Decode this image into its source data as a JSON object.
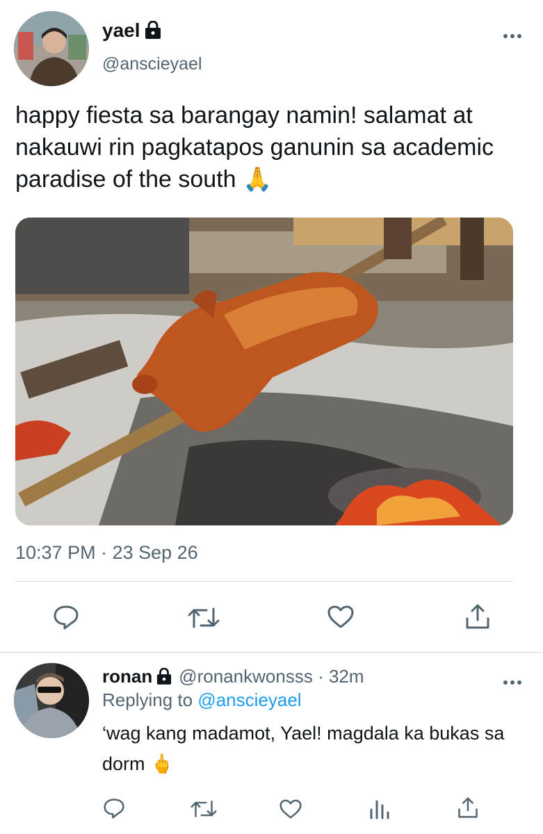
{
  "tweet": {
    "author_name": "yael",
    "author_handle": "@anscieyael",
    "protected_icon": "lock-icon",
    "text": "happy fiesta sa barangay namin! salamat at nakauwi rin pagkatapos ganunin sa academic paradise of the south 🙏",
    "timestamp": "10:37 PM · 23 Sep 26",
    "actions": [
      "reply-icon",
      "retweet-icon",
      "like-icon",
      "share-icon"
    ]
  },
  "reply": {
    "author_name": "ronan",
    "author_handle": "@ronankwonsss",
    "separator": "·",
    "age": "32m",
    "replying_prefix": "Replying to",
    "replying_to": "@anscieyael",
    "text": "‘wag kang madamot, Yael! magdala ka bukas sa dorm 🖕",
    "actions": [
      "reply-icon",
      "retweet-icon",
      "like-icon",
      "analytics-icon",
      "share-icon"
    ]
  },
  "colors": {
    "text_primary": "#0f1419",
    "text_secondary": "#536471",
    "link": "#1d9bf0",
    "divider": "#cfd9de"
  }
}
